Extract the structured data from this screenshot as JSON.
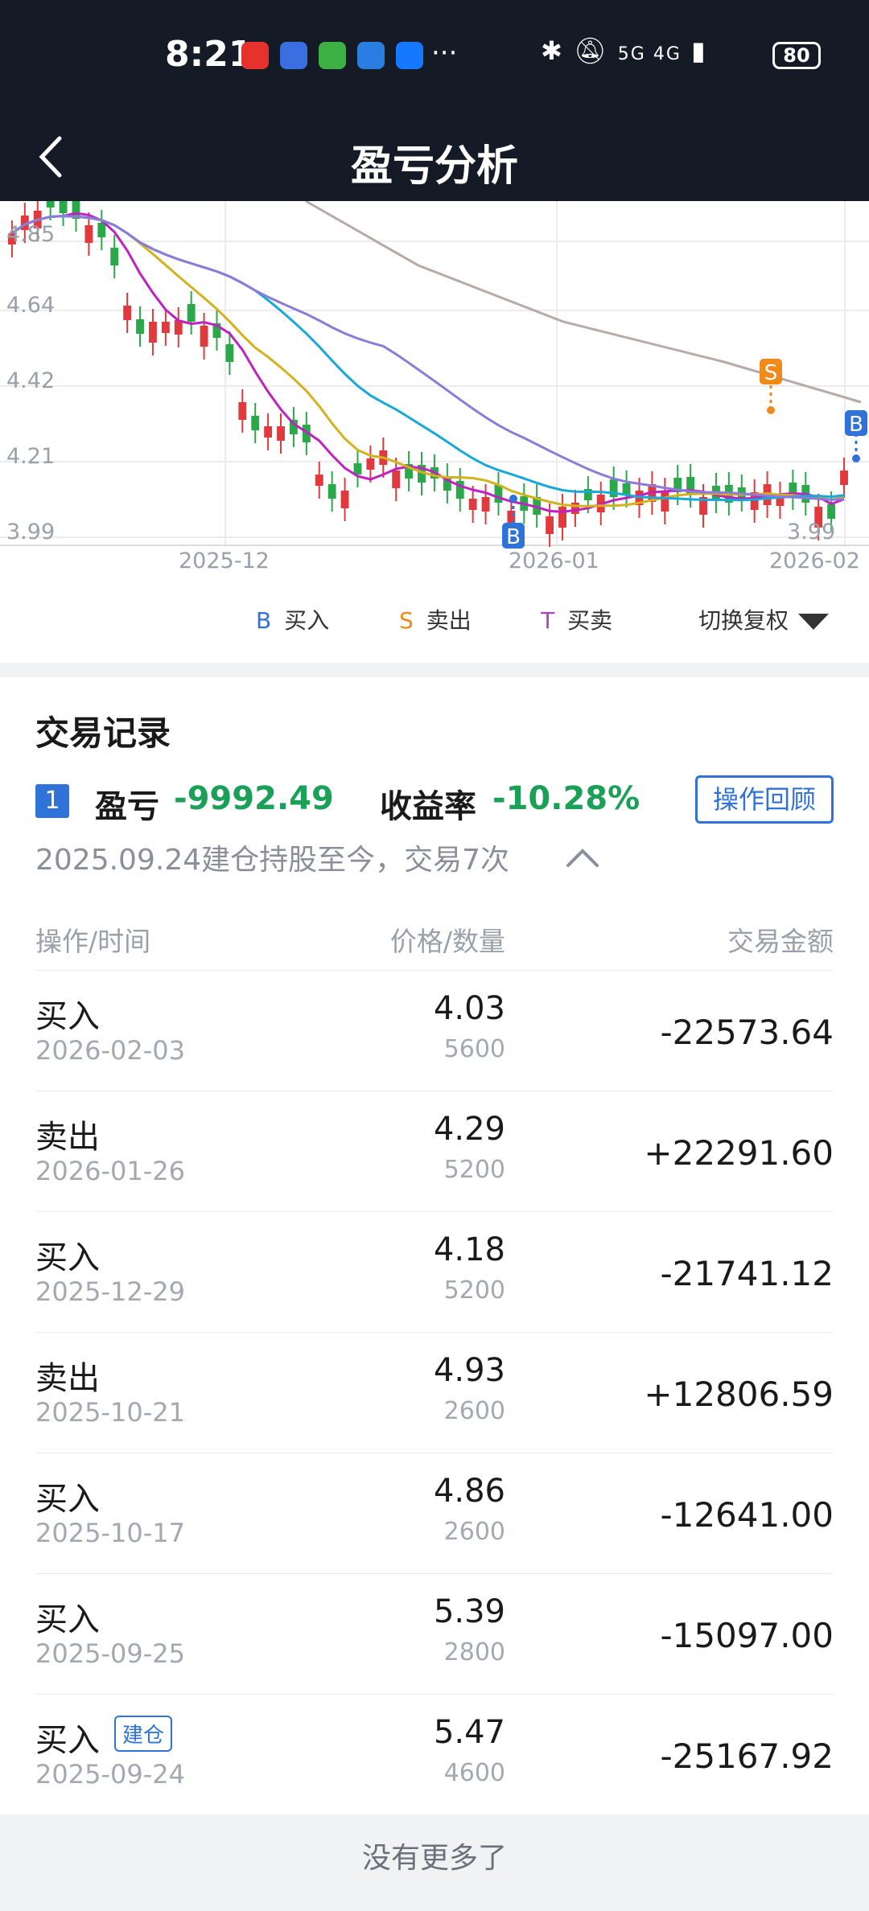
{
  "status_bar": {
    "time": "8:21",
    "more": "···",
    "network": "5G 4G",
    "battery": "80"
  },
  "header": {
    "title": "盈亏分析"
  },
  "chart": {
    "y_labels": [
      "4.85",
      "4.64",
      "4.42",
      "4.21",
      "3.99"
    ],
    "y_right_label": "3.99",
    "x_labels": [
      "2025-12",
      "2026-01",
      "2026-02"
    ],
    "markers": {
      "buy": "B",
      "sell": "S"
    },
    "colors": {
      "up": "#e03a3e",
      "down": "#2aa84a",
      "ma5": "#c022c0",
      "ma10": "#d4b21e",
      "ma20": "#17a9d8",
      "ma30": "#8c7bd8",
      "ma60": "#b8aaa6",
      "buy": "#2f73d8",
      "sell": "#f08a1a"
    }
  },
  "legend": {
    "buy_key": "B",
    "buy_label": "买入",
    "sell_key": "S",
    "sell_label": "卖出",
    "trade_key": "T",
    "trade_label": "买卖",
    "switch_label": "切换复权"
  },
  "records": {
    "section_title": "交易记录",
    "index": "1",
    "pl_label": "盈亏",
    "pl_value": "-9992.49",
    "rate_label": "收益率",
    "rate_value": "-10.28%",
    "review_button": "操作回顾",
    "subtext": "2025.09.24建仓持股至今，交易7次",
    "columns": {
      "op_time": "操作/时间",
      "price_qty": "价格/数量",
      "amount": "交易金额"
    },
    "rows": [
      {
        "op": "买入",
        "date": "2026-02-03",
        "price": "4.03",
        "qty": "5600",
        "amount": "-22573.64"
      },
      {
        "op": "卖出",
        "date": "2026-01-26",
        "price": "4.29",
        "qty": "5200",
        "amount": "+22291.60"
      },
      {
        "op": "买入",
        "date": "2025-12-29",
        "price": "4.18",
        "qty": "5200",
        "amount": "-21741.12"
      },
      {
        "op": "卖出",
        "date": "2025-10-21",
        "price": "4.93",
        "qty": "2600",
        "amount": "+12806.59"
      },
      {
        "op": "买入",
        "date": "2025-10-17",
        "price": "4.86",
        "qty": "2600",
        "amount": "-12641.00"
      },
      {
        "op": "买入",
        "date": "2025-09-25",
        "price": "5.39",
        "qty": "2800",
        "amount": "-15097.00"
      },
      {
        "op": "买入",
        "date": "2025-09-24",
        "price": "5.47",
        "qty": "4600",
        "amount": "-25167.92",
        "tag": "建仓"
      }
    ],
    "footer": "没有更多了"
  }
}
